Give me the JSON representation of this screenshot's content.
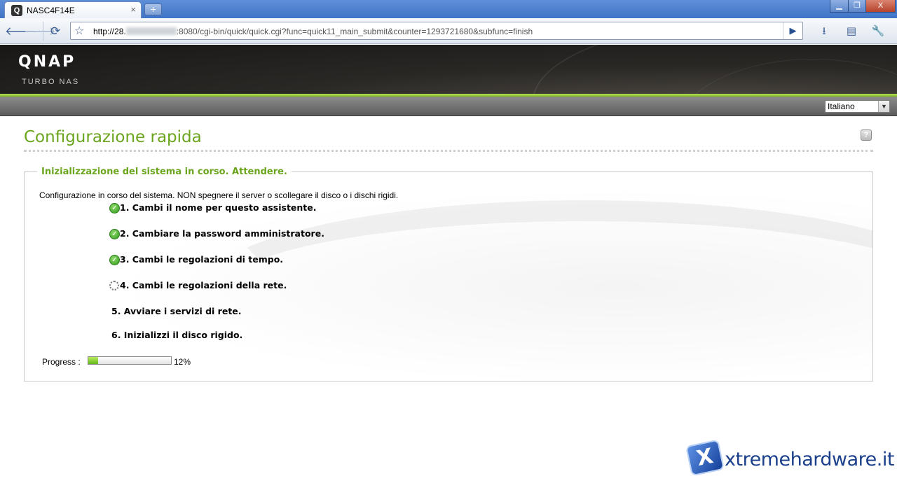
{
  "browser": {
    "tab_title": "NASC4F14E",
    "tab_favicon": "Q",
    "tab_close": "×",
    "new_tab": "+",
    "url_prefix": "http://28.",
    "url_rest": ":8080/cgi-bin/quick/quick.cgi?func=quick11_main_submit&counter=1293721680&subfunc=finish",
    "window_controls": [
      "▁",
      "❐",
      "X"
    ]
  },
  "header": {
    "logo": "QNAP",
    "subtitle": "TURBO NAS",
    "language": "Italiano"
  },
  "main": {
    "title": "Configurazione rapida",
    "help": "?",
    "legend": "Inizializzazione del sistema in corso. Attendere.",
    "notice": "Configurazione in corso del sistema. NON spegnere il server o scollegare il disco o i dischi rigidi.",
    "steps": [
      {
        "label": "1. Cambi il nome per questo assistente.",
        "status": "done"
      },
      {
        "label": "2. Cambiare la password amministratore.",
        "status": "done"
      },
      {
        "label": "3. Cambi le regolazioni di tempo.",
        "status": "done"
      },
      {
        "label": "4. Cambi le regolazioni della rete.",
        "status": "in-progress"
      },
      {
        "label": "5. Avviare i servizi di rete.",
        "status": "pending"
      },
      {
        "label": "6. Inizializzi il disco rigido.",
        "status": "pending"
      }
    ],
    "progress_label": "Progress :",
    "progress_value": 12,
    "progress_text": "12%"
  },
  "watermark": {
    "badge": "X",
    "text": "xtremehardware.it"
  },
  "colors": {
    "accent_green": "#6ba51e",
    "progress_green": "#63b81b",
    "chrome_blue": "#3f74c6"
  }
}
